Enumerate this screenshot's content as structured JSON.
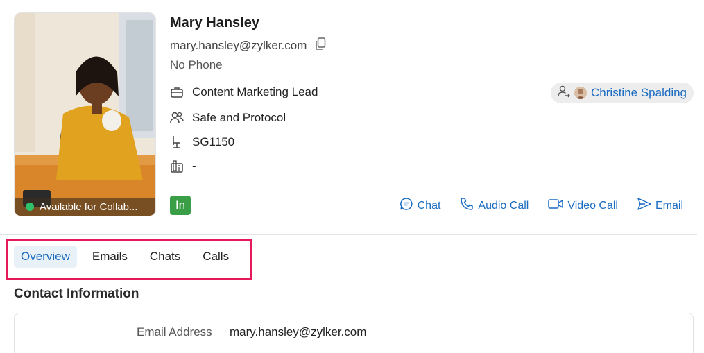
{
  "profile": {
    "name": "Mary Hansley",
    "email": "mary.hansley@zylker.com",
    "phone": "No Phone",
    "presence": "Available for Collab...",
    "title": "Content Marketing Lead",
    "department": "Safe and Protocol",
    "seat": "SG1150",
    "extension": "-",
    "badge": "In",
    "manager": "Christine Spalding"
  },
  "icons": {
    "copy": "copy-icon",
    "title": "briefcase-icon",
    "department": "people-icon",
    "seat": "chair-icon",
    "extension": "fax-icon",
    "manager": "reporting-to-icon",
    "chat": "chat-icon",
    "audio": "phone-icon",
    "video": "video-icon",
    "email": "send-icon"
  },
  "actions": {
    "chat": "Chat",
    "audio_call": "Audio Call",
    "video_call": "Video Call",
    "email": "Email"
  },
  "tabs": [
    {
      "label": "Overview",
      "active": true
    },
    {
      "label": "Emails",
      "active": false
    },
    {
      "label": "Chats",
      "active": false
    },
    {
      "label": "Calls",
      "active": false
    }
  ],
  "contact_info": {
    "title": "Contact Information",
    "rows": [
      {
        "label": "Email Address",
        "value": "mary.hansley@zylker.com"
      }
    ]
  },
  "colors": {
    "accent": "#1a6cc2",
    "presence_green": "#2ec36b",
    "badge_green": "#3a9e47",
    "highlight_box": "#e6195b"
  }
}
